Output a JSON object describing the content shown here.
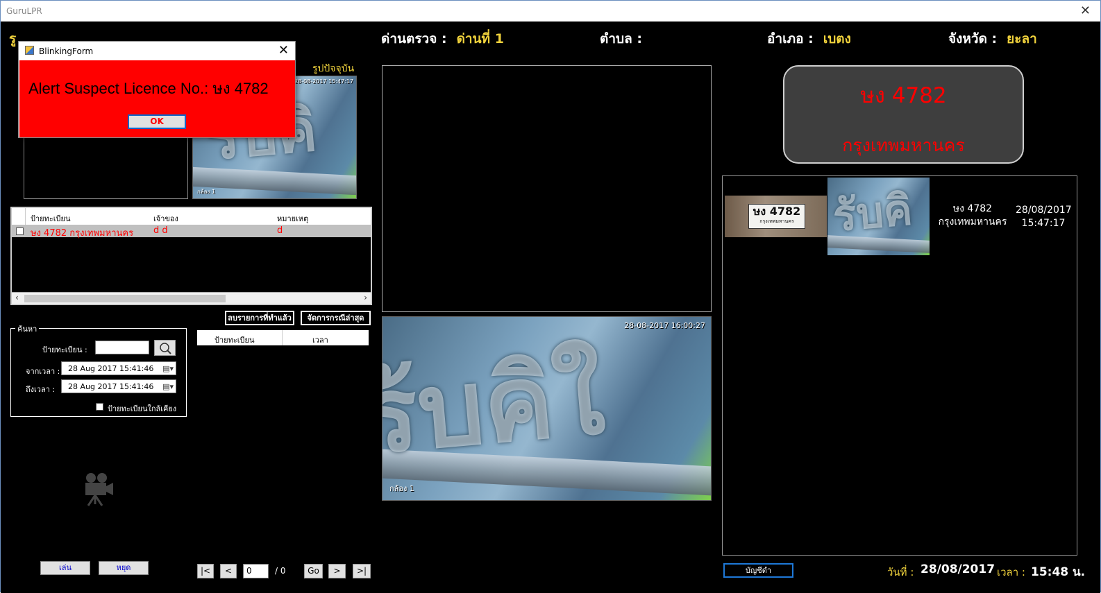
{
  "window": {
    "title": "GuruLPR",
    "close_glyph": "✕"
  },
  "header": {
    "checkpoint_label": "ด่านตรวจ :",
    "checkpoint_value": "ด่านที่ 1",
    "subdistrict_label": "ตำบล :",
    "subdistrict_value": "",
    "district_label": "อำเภอ :",
    "district_value": "เบตง",
    "province_label": "จังหวัด :",
    "province_value": "ยะลา",
    "left_partial": "รู"
  },
  "current_image_label": "รูปปัจจุบัน",
  "suspect_grid": {
    "columns": [
      "ป้ายทะเบียน",
      "เจ้าของ",
      "หมายเหตุ"
    ],
    "rows": [
      {
        "plate": "ษง 4782 กรุงเทพมหานคร",
        "owner": "d d",
        "note": "d"
      }
    ]
  },
  "buttons": {
    "delete_done": "ลบรายการที่ทำแล้ว",
    "latest_case": "จัดการกรณีล่าสุด",
    "play": "เล่น",
    "stop": "หยุด",
    "blacklist": "บัญชีดำ"
  },
  "result_list": {
    "columns": [
      "ป้ายทะเบียน",
      "เวลา"
    ]
  },
  "search": {
    "legend": "ค้นหา",
    "plate_label": "ป้ายทะเบียน :",
    "plate_value": "",
    "from_label": "จากเวลา :",
    "from_value": "28 Aug 2017   15:41:46",
    "to_label": "ถึงเวลา :",
    "to_value": "28 Aug 2017   15:41:46",
    "similar_label": "ป้ายทะเบียนใกล้เคียง"
  },
  "pager": {
    "first": "|<",
    "prev": "<",
    "page": "0",
    "total": "/ 0",
    "go": "Go",
    "next": ">",
    "last": ">|"
  },
  "camera_feed": {
    "timestamp": "28-08-2017 16:00:27",
    "camera_label": "กล้อง 1"
  },
  "current_thumb": {
    "stamp_top": "28-08-2017 15:47:17",
    "stamp_bottom": "กล้อง 1"
  },
  "plate_display": {
    "number": "ษง 4782",
    "province": "กรุงเทพมหานคร",
    "color": "#ff0000"
  },
  "history": [
    {
      "plate": "ษง 4782",
      "province": "กรุงเทพมหานคร",
      "date": "28/08/2017",
      "time": "15:47:17",
      "plate_crop": "ษง 4782",
      "plate_crop_sub": "กรุงเทพมหานคร"
    }
  ],
  "footer": {
    "date_label": "วันที่ :",
    "date_value": "28/08/2017",
    "time_label": "เวลา :",
    "time_value": "15:48 น."
  },
  "dialog": {
    "title": "BlinkingForm",
    "message": "Alert Suspect Licence No.: ษง 4782",
    "ok": "OK",
    "close_glyph": "✕"
  },
  "colors": {
    "accent_yellow": "#f0d23c",
    "alert_red": "#ff0000",
    "background": "#000000"
  }
}
